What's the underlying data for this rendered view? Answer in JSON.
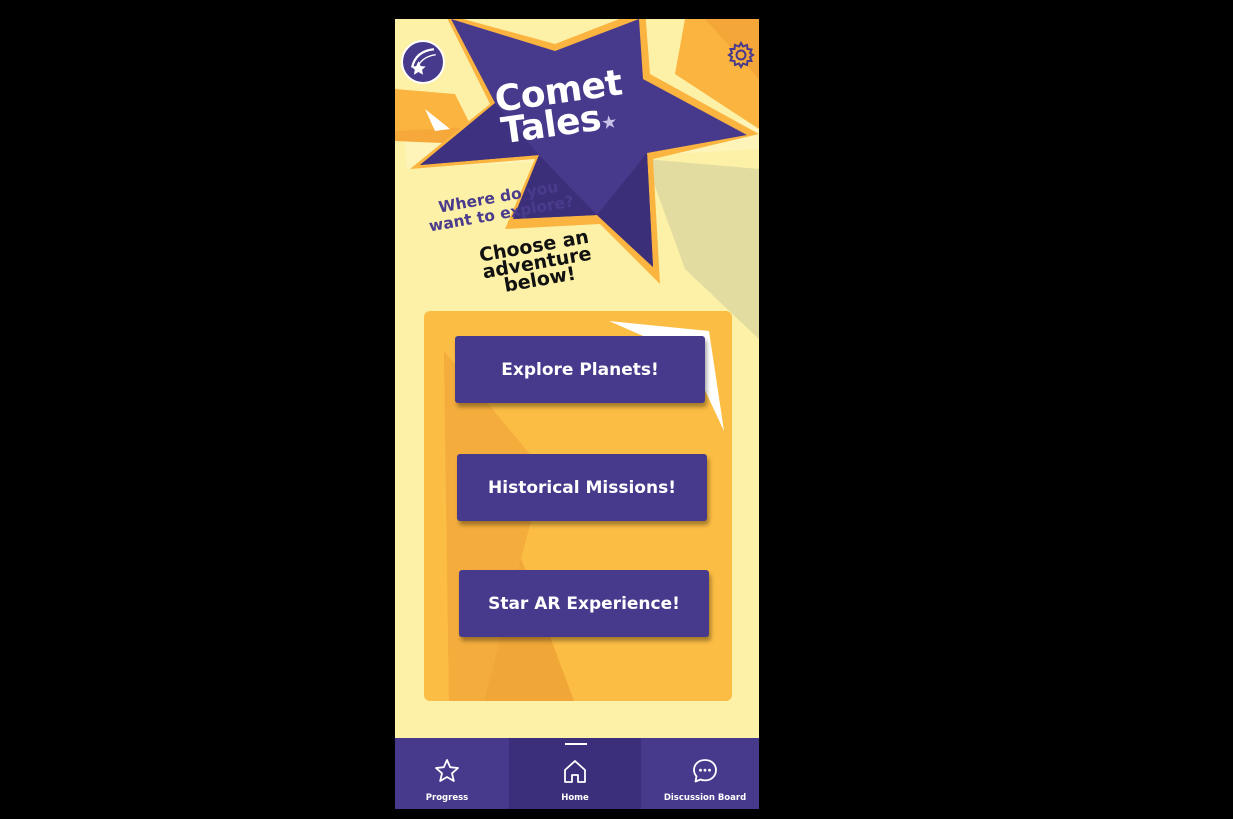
{
  "app": {
    "title_line1": "Comet",
    "title_line2": "Tales",
    "logo_icon": "shooting-star-icon",
    "settings_icon": "gear-icon"
  },
  "hero": {
    "question": "Where do you want to explore?",
    "prompt": "Choose an adventure below!"
  },
  "adventures": [
    {
      "label": "Explore Planets!"
    },
    {
      "label": "Historical Missions!"
    },
    {
      "label": "Star AR Experience!"
    }
  ],
  "nav": {
    "active": "Home",
    "items": [
      {
        "label": "Progress",
        "icon": "star-icon"
      },
      {
        "label": "Home",
        "icon": "home-icon"
      },
      {
        "label": "Discussion Board",
        "icon": "chat-icon"
      }
    ]
  },
  "colors": {
    "brand_purple": "#473a8c",
    "accent_orange": "#fbb43f",
    "background_yellow": "#fdf1a8",
    "frame_black": "#000000"
  }
}
